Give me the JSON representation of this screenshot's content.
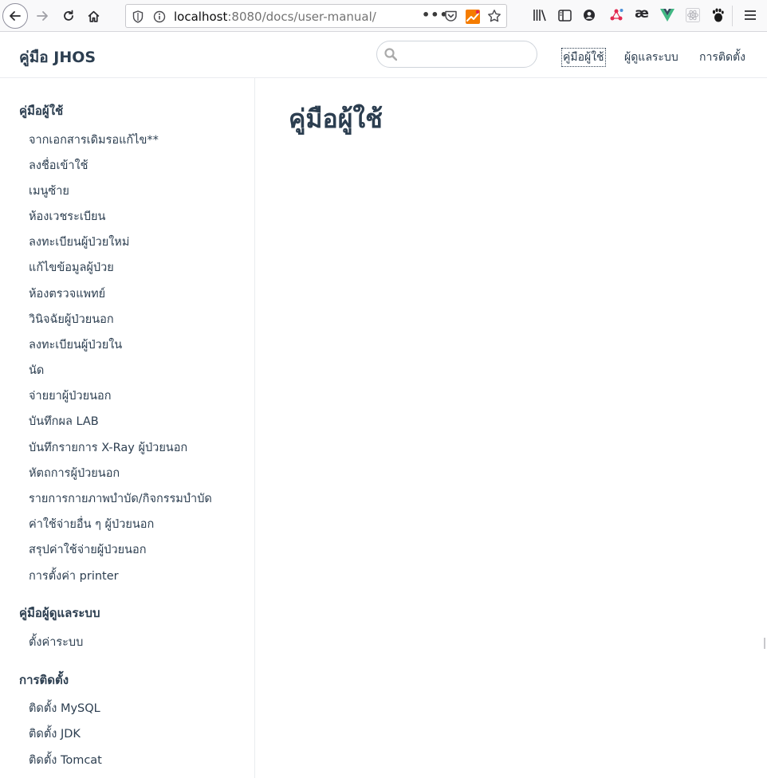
{
  "browser": {
    "url_host": "localhost",
    "url_rest": ":8080/docs/user-manual/",
    "overflow_dots": "•••",
    "ligature_icon_text": "æ"
  },
  "header": {
    "site_title": "คู่มือ JHOS",
    "search_placeholder": "",
    "nav": [
      {
        "label": "คู่มือผู้ใช้"
      },
      {
        "label": "ผู้ดูแลระบบ"
      },
      {
        "label": "การติดตั้ง"
      }
    ]
  },
  "sidebar": {
    "groups": [
      {
        "title": "คู่มือผู้ใช้",
        "items": [
          "จากเอกสารเดิมรอแก้ไข**",
          "ลงชื่อเข้าใช้",
          "เมนูซ้าย",
          "ห้องเวชระเบียน",
          "ลงทะเบียนผู้ป่วยใหม่",
          "แก้ไขข้อมูลผู้ป่วย",
          "ห้องตรวจแพทย์",
          "วินิจฉัยผู้ป่วยนอก",
          "ลงทะเบียนผู้ป่วยใน",
          "นัด",
          "จ่ายยาผู้ป่วยนอก",
          "บันทึกผล LAB",
          "บันทึกรายการ X-Ray ผู้ป่วยนอก",
          "หัตถการผู้ป่วยนอก",
          "รายการกายภาพบำบัด/กิจกรรมบำบัด",
          "ค่าใช้จ่ายอื่น ๆ ผู้ป่วยนอก",
          "สรุปค่าใช้จ่ายผู้ป่วยนอก",
          "การตั้งค่า printer"
        ]
      },
      {
        "title": "คู่มือผู้ดูแลระบบ",
        "items": [
          "ตั้งค่าระบบ"
        ]
      },
      {
        "title": "การติดตั้ง",
        "items": [
          "ติดตั้ง MySQL",
          "ติดตั้ง JDK",
          "ติดตั้ง Tomcat"
        ]
      }
    ]
  },
  "main": {
    "title": "คู่มือผู้ใช้"
  },
  "colors": {
    "text": "#2c3e50",
    "vue_green": "#41b883",
    "ext_orange": "#f57c00",
    "ext_red": "#e22850"
  }
}
